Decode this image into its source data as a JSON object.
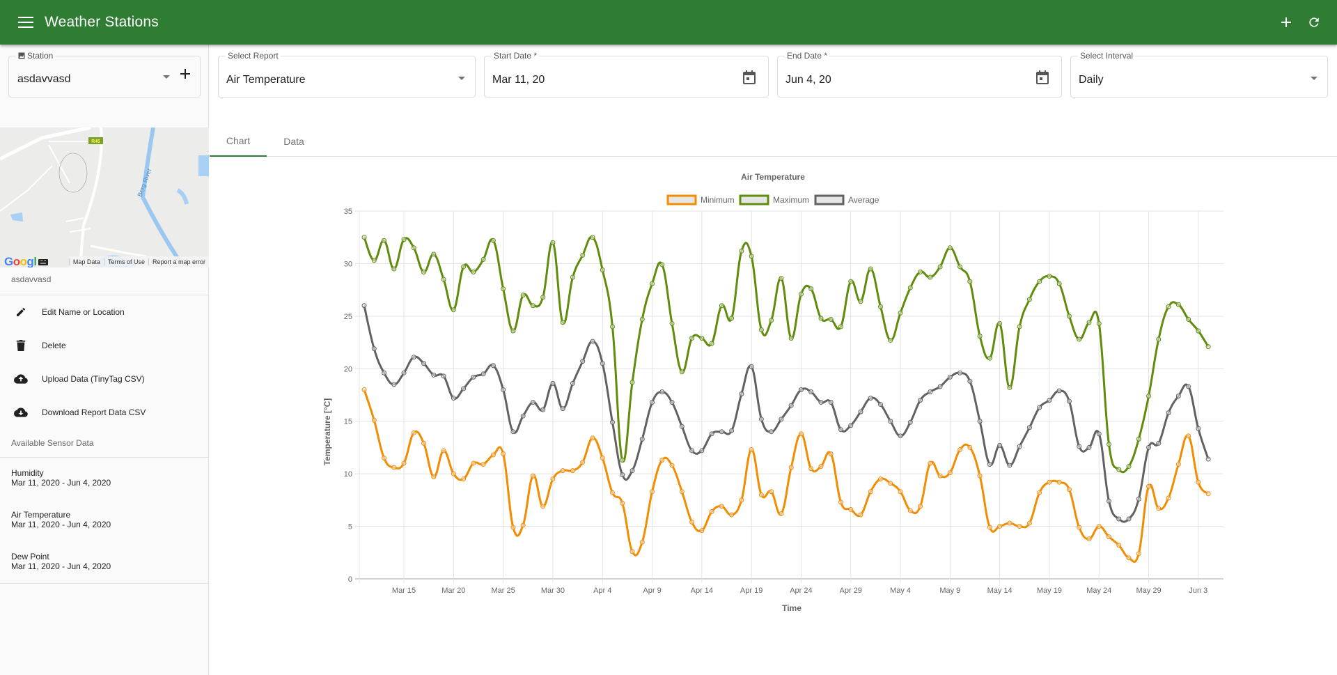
{
  "appbar": {
    "title": "Weather Stations",
    "menu_icon": "menu-icon",
    "actions": [
      {
        "name": "add-station-button",
        "icon": "plus-icon"
      },
      {
        "name": "refresh-button",
        "icon": "refresh-icon"
      }
    ]
  },
  "sidebar": {
    "station_field": {
      "label": "Station",
      "value": "asdavvasd"
    },
    "map": {
      "road_label": "R45",
      "river_label": "Berg River",
      "logo": "Google",
      "links": [
        "Map Data",
        "Terms of Use",
        "Report a map error"
      ]
    },
    "station_name": "asdavvasd",
    "actions": [
      {
        "label": "Edit Name or Location",
        "icon": "pencil-icon"
      },
      {
        "label": "Delete",
        "icon": "trash-icon"
      },
      {
        "label": "Upload Data (TinyTag CSV)",
        "icon": "cloud-upload-icon"
      },
      {
        "label": "Download Report Data CSV",
        "icon": "cloud-download-icon"
      }
    ],
    "sensor_header": "Available Sensor Data",
    "sensors": [
      {
        "name": "Humidity",
        "range": "Mar 11, 2020 - Jun 4, 2020"
      },
      {
        "name": "Air Temperature",
        "range": "Mar 11, 2020 - Jun 4, 2020"
      },
      {
        "name": "Dew Point",
        "range": "Mar 11, 2020 - Jun 4, 2020"
      }
    ]
  },
  "filters": {
    "report": {
      "label": "Select Report",
      "value": "Air Temperature"
    },
    "start_date": {
      "label": "Start Date *",
      "value": "Mar 11, 20"
    },
    "end_date": {
      "label": "End Date *",
      "value": "Jun 4, 20"
    },
    "interval": {
      "label": "Select Interval",
      "value": "Daily"
    }
  },
  "tabs": [
    {
      "label": "Chart",
      "active": true
    },
    {
      "label": "Data",
      "active": false
    }
  ],
  "chart_data": {
    "type": "line",
    "title": "Air Temperature",
    "xlabel": "Time",
    "ylabel": "Temperature [°C]",
    "x_start": "2020-03-11",
    "x_end": "2020-06-04",
    "interval": "daily",
    "ylim": [
      0,
      35
    ],
    "yticks": [
      0,
      5,
      10,
      15,
      20,
      25,
      30,
      35
    ],
    "xtick_labels": [
      "Mar 15",
      "Mar 20",
      "Mar 25",
      "Mar 30",
      "Apr 4",
      "Apr 9",
      "Apr 14",
      "Apr 19",
      "Apr 24",
      "Apr 29",
      "May 4",
      "May 9",
      "May 14",
      "May 19",
      "May 24",
      "May 29",
      "Jun 3"
    ],
    "xtick_day_offsets": [
      4,
      9,
      14,
      19,
      24,
      29,
      34,
      39,
      44,
      49,
      54,
      59,
      64,
      69,
      74,
      79,
      84
    ],
    "grid": true,
    "legend_position": "top",
    "series": [
      {
        "name": "Minimum",
        "color": "#f28c00",
        "values": [
          18.0,
          15.1,
          11.5,
          10.6,
          11.0,
          13.9,
          12.9,
          9.7,
          12.2,
          10.0,
          9.5,
          11.0,
          10.9,
          11.8,
          11.9,
          4.9,
          5.1,
          9.8,
          6.9,
          9.5,
          10.3,
          10.3,
          11.1,
          13.4,
          11.5,
          8.2,
          7.2,
          2.6,
          3.5,
          8.3,
          11.3,
          10.8,
          8.3,
          5.4,
          4.6,
          6.4,
          6.9,
          6.1,
          7.5,
          12.3,
          8.0,
          8.3,
          6.2,
          10.6,
          13.8,
          10.5,
          10.7,
          11.9,
          7.3,
          6.6,
          6.1,
          8.3,
          9.5,
          9.1,
          8.3,
          6.5,
          6.9,
          11.0,
          9.8,
          10.1,
          12.3,
          12.5,
          9.8,
          4.9,
          5.0,
          5.3,
          5.0,
          5.3,
          8.2,
          9.2,
          9.2,
          8.5,
          4.9,
          3.8,
          5.0,
          4.0,
          3.2,
          2.0,
          2.4,
          8.8,
          6.7,
          7.7,
          10.9,
          13.6,
          9.2,
          8.1
        ]
      },
      {
        "name": "Maximum",
        "color": "#5f8c0a",
        "values": [
          32.5,
          30.3,
          32.2,
          29.5,
          32.3,
          31.5,
          29.2,
          30.9,
          28.5,
          25.6,
          29.7,
          29.2,
          30.4,
          32.2,
          27.6,
          23.6,
          27.0,
          26.0,
          26.8,
          32.0,
          24.4,
          28.7,
          30.8,
          32.5,
          29.4,
          24.0,
          11.3,
          18.7,
          24.7,
          28.1,
          29.9,
          24.3,
          19.7,
          22.9,
          22.9,
          22.4,
          26.0,
          24.8,
          31.2,
          30.7,
          23.7,
          24.6,
          28.6,
          22.9,
          27.1,
          27.6,
          24.8,
          24.7,
          24.0,
          28.3,
          26.4,
          29.5,
          25.9,
          22.7,
          25.3,
          27.7,
          29.2,
          28.7,
          29.7,
          31.5,
          29.7,
          28.3,
          23.1,
          21.0,
          24.3,
          18.2,
          24.0,
          26.6,
          28.3,
          28.8,
          28.1,
          25.0,
          22.8,
          24.4,
          24.3,
          12.8,
          10.4,
          10.7,
          13.3,
          17.4,
          22.8,
          25.9,
          26.1,
          24.7,
          23.6,
          22.1
        ]
      },
      {
        "name": "Average",
        "color": "#616161",
        "values": [
          26.0,
          21.9,
          19.6,
          18.5,
          19.6,
          21.1,
          20.5,
          19.4,
          19.3,
          17.2,
          18.1,
          19.2,
          19.5,
          20.3,
          18.0,
          14.0,
          15.5,
          16.8,
          16.1,
          18.6,
          16.2,
          18.6,
          20.7,
          22.6,
          20.5,
          14.9,
          9.9,
          10.3,
          13.3,
          16.8,
          17.8,
          16.8,
          14.5,
          12.2,
          12.2,
          13.8,
          14.0,
          14.1,
          17.6,
          20.2,
          15.2,
          14.0,
          15.2,
          16.5,
          18.0,
          17.8,
          16.8,
          16.8,
          14.2,
          14.6,
          15.9,
          17.2,
          16.6,
          15.0,
          13.6,
          14.9,
          17.0,
          17.8,
          18.3,
          19.2,
          19.6,
          18.8,
          15.0,
          10.9,
          12.7,
          10.8,
          12.6,
          14.4,
          16.3,
          17.0,
          17.9,
          16.9,
          12.6,
          12.5,
          13.8,
          7.4,
          5.7,
          5.7,
          7.6,
          12.5,
          12.9,
          15.8,
          17.4,
          18.3,
          14.3,
          11.4
        ]
      }
    ]
  }
}
